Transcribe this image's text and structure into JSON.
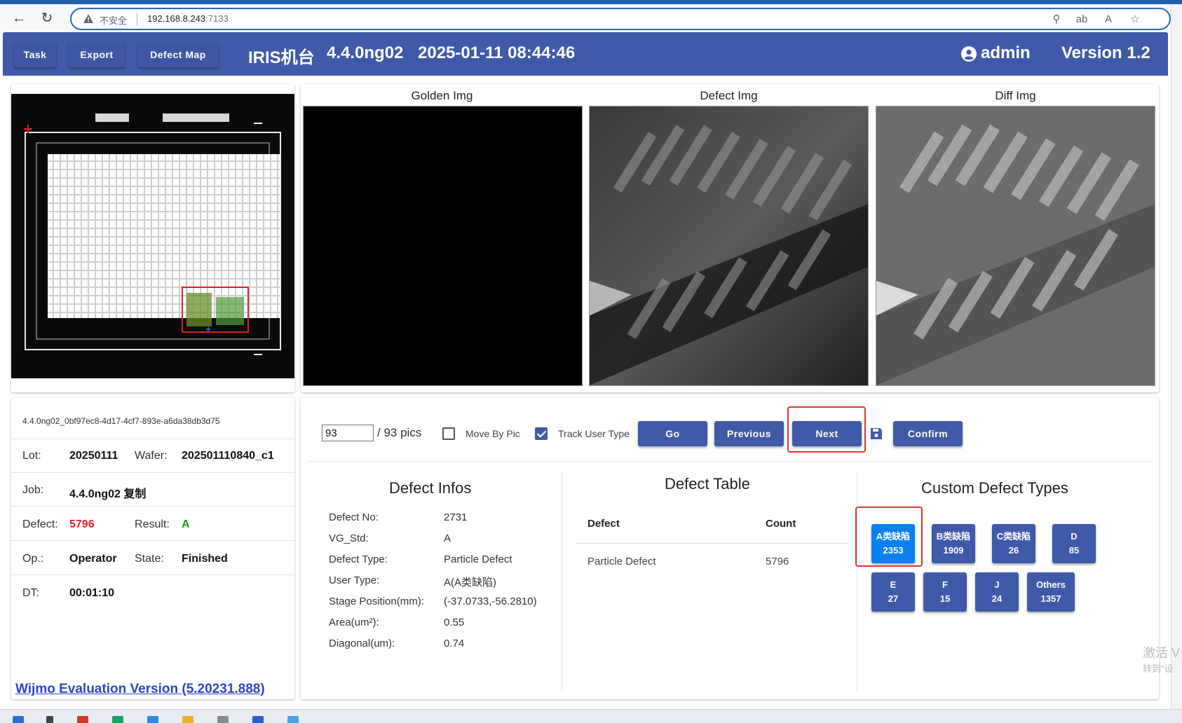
{
  "browser": {
    "insecure_label": "不安全",
    "url_host": "192.168.8.243",
    "url_port": ":7133"
  },
  "header": {
    "task_label": "Task",
    "export_label": "Export",
    "defect_map_label": "Defect Map",
    "machine": "IRIS机台",
    "recipe": "4.4.0ng02",
    "datetime": "2025-01-11 08:44:46",
    "user": "admin",
    "version": "Version 1.2"
  },
  "images": {
    "golden_title": "Golden Img",
    "defect_title": "Defect Img",
    "diff_title": "Diff Img"
  },
  "info": {
    "id": "4.4.0ng02_0bf97ec8-4d17-4cf7-893e-a6da38db3d75",
    "lot_label": "Lot:",
    "lot": "20250111",
    "wafer_label": "Wafer:",
    "wafer": "202501110840_c1",
    "job_label": "Job:",
    "job": "4.4.0ng02 复制",
    "defect_label": "Defect:",
    "defect": "5796",
    "result_label": "Result:",
    "result": "A",
    "op_label": "Op.:",
    "op": "Operator",
    "state_label": "State:",
    "state": "Finished",
    "dt_label": "DT:",
    "dt": "00:01:10",
    "wijmo": "Wijmo Evaluation Version (5.20231.888)"
  },
  "controls": {
    "pic_value": "93",
    "pic_total": "/ 93 pics",
    "move_by_pic": "Move By Pic",
    "move_by_pic_checked": false,
    "track_user_type": "Track User Type",
    "track_user_type_checked": true,
    "go": "Go",
    "previous": "Previous",
    "next": "Next",
    "confirm": "Confirm"
  },
  "defect_infos": {
    "title": "Defect Infos",
    "rows": [
      {
        "label": "Defect No:",
        "value": "2731"
      },
      {
        "label": "VG_Std:",
        "value": "A"
      },
      {
        "label": "Defect Type:",
        "value": "Particle Defect"
      },
      {
        "label": "User Type:",
        "value": "A(A类缺陷)"
      },
      {
        "label": "Stage Position(mm):",
        "value": "(-37.0733,-56.2810)"
      },
      {
        "label": "Area(um²):",
        "value": "0.55"
      },
      {
        "label": "Diagonal(um):",
        "value": "0.74"
      }
    ]
  },
  "defect_table": {
    "title": "Defect Table",
    "columns": [
      "Defect",
      "Count"
    ],
    "rows": [
      {
        "defect": "Particle Defect",
        "count": "5796"
      }
    ]
  },
  "custom_types": {
    "title": "Custom Defect Types",
    "items": [
      {
        "name": "A类缺陷",
        "count": "2353"
      },
      {
        "name": "B类缺陷",
        "count": "1909"
      },
      {
        "name": "C类缺陷",
        "count": "26"
      },
      {
        "name": "D",
        "count": "85"
      },
      {
        "name": "E",
        "count": "27"
      },
      {
        "name": "F",
        "count": "15"
      },
      {
        "name": "J",
        "count": "24"
      },
      {
        "name": "Others",
        "count": "1357"
      }
    ]
  },
  "watermark": {
    "line1": "激活 V",
    "line2": "转到\"设"
  },
  "colors": {
    "header_bg": "#3f5aa9",
    "button_bg": "#3f5aa9",
    "active_type": "#0b80f0",
    "defect_count": "#e02020",
    "result_ok": "#1a9a1a",
    "highlight_box": "#e0352b"
  }
}
